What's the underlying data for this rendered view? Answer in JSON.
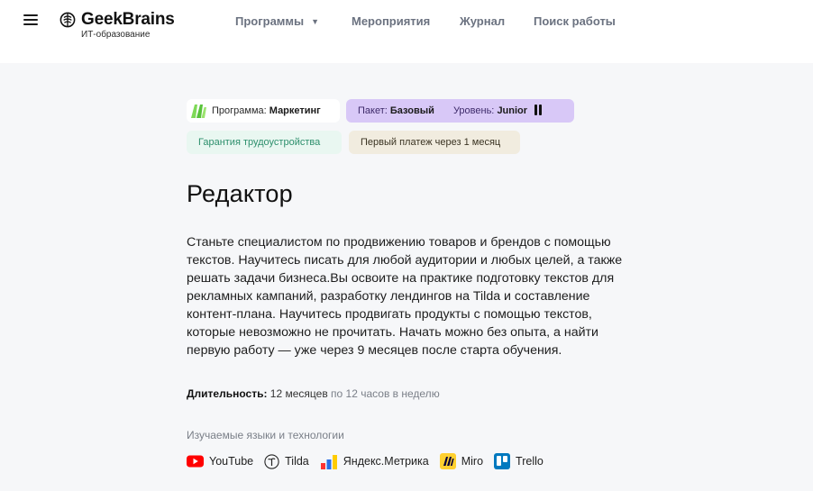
{
  "header": {
    "logo_name": "GeekBrains",
    "logo_tagline": "ИТ-образование",
    "nav": [
      "Программы",
      "Мероприятия",
      "Журнал",
      "Поиск работы"
    ]
  },
  "badges": {
    "program_prefix": "Программа:",
    "program_value": "Маркетинг",
    "package_prefix": "Пакет:",
    "package_value": "Базовый",
    "level_prefix": "Уровень:",
    "level_value": "Junior",
    "guarantee": "Гарантия трудоустройства",
    "payment": "Первый платеж через 1 месяц"
  },
  "course": {
    "title": "Редактор",
    "description": "Станьте специалистом по продвижению товаров и брендов с помощью текстов. Научитесь писать для любой аудитории и любых целей, а также решать задачи бизнеса.Вы освоите на практике подготовку текстов для рекламных кампаний, разработку лендингов на Tilda и составление контент-плана. Научитесь продвигать продукты с помощью текстов, которые невозможно не прочитать. Начать можно без опыта, а найти первую работу — уже через 9 месяцев после старта обучения.",
    "duration_label": "Длительность:",
    "duration_value": "12 месяцев",
    "duration_note": "по 12 часов в неделю"
  },
  "tech": {
    "heading": "Изучаемые языки и технологии",
    "items": [
      {
        "label": "YouTube",
        "icon": "youtube-icon"
      },
      {
        "label": "Tilda",
        "icon": "tilda-icon"
      },
      {
        "label": "Яндекс.Метрика",
        "icon": "yandex-metrika-icon"
      },
      {
        "label": "Miro",
        "icon": "miro-icon"
      },
      {
        "label": "Trello",
        "icon": "trello-icon"
      }
    ]
  },
  "colors": {
    "page_bg": "#f6f7f9",
    "package_chip": "#d8c8f7",
    "guarantee_chip": "#e9f7f1",
    "payment_chip": "#f1ecdf",
    "youtube": "#ff0000",
    "miro": "#ffd02f",
    "trello": "#0079bf"
  }
}
